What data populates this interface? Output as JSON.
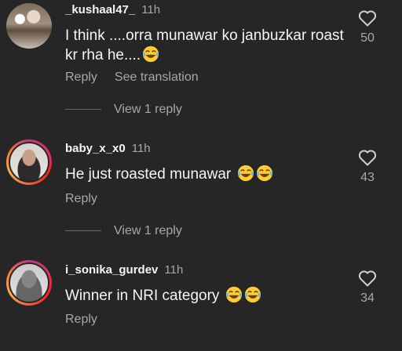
{
  "comments": [
    {
      "username": "_kushaal47_",
      "time": "11h",
      "text": "I think ....orra munawar ko janbuzkar roast kr rha he....",
      "emoji_icon": "laughing-crying-emoji-icon",
      "emoji_count": 1,
      "likes": "50",
      "reply_label": "Reply",
      "translate_label": "See translation",
      "view_replies_label": "View 1 reply",
      "avatar_icon": "profile-photo"
    },
    {
      "username": "baby_x_x0",
      "time": "11h",
      "text": "He just roasted munawar",
      "emoji_icon": "laughing-crying-emoji-icon",
      "emoji_count": 2,
      "likes": "43",
      "reply_label": "Reply",
      "view_replies_label": "View 1 reply",
      "avatar_icon": "profile-photo"
    },
    {
      "username": "i_sonika_gurdev",
      "time": "11h",
      "text": "Winner in NRI category",
      "emoji_icon": "laughing-crying-emoji-icon",
      "emoji_count": 2,
      "likes": "34",
      "reply_label": "Reply",
      "avatar_icon": "profile-photo"
    }
  ],
  "colors": {
    "background": "#262626",
    "primary_text": "#f5f5f5",
    "secondary_text": "#a8a8a8",
    "story_ring": "#e1306c"
  },
  "icons": {
    "like": "heart-outline-icon"
  }
}
